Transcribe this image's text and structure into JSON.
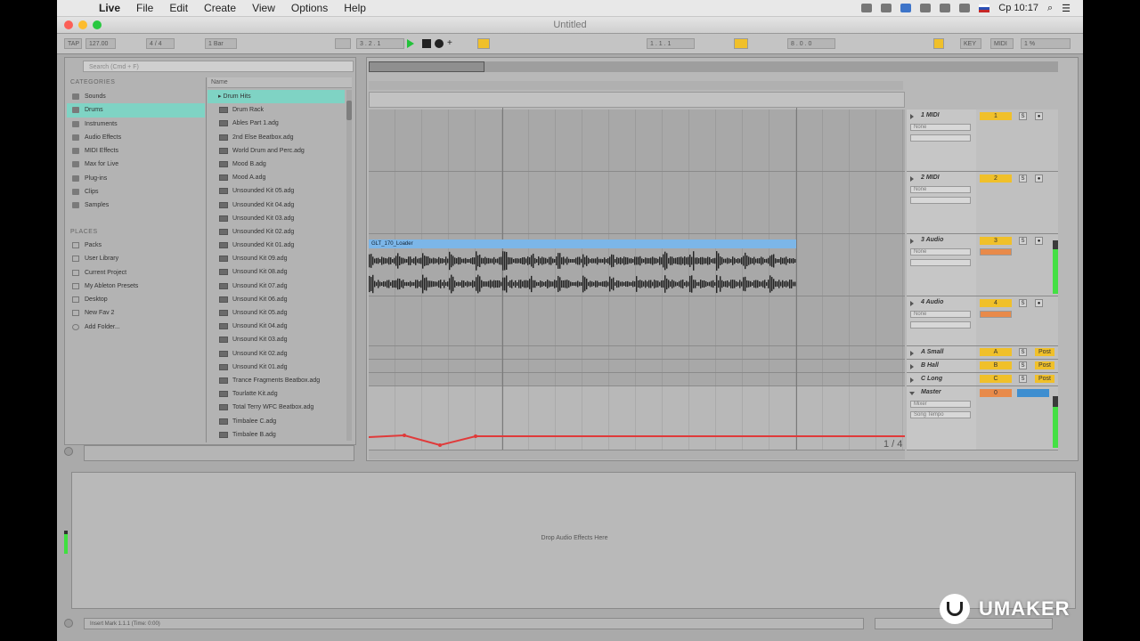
{
  "menubar": {
    "items": [
      "Live",
      "File",
      "Edit",
      "Create",
      "View",
      "Options",
      "Help"
    ],
    "clock": "Ср 10:17"
  },
  "window": {
    "title": "Untitled"
  },
  "transport": {
    "tap": "TAP",
    "tempo": "127.00",
    "signature": "4 / 4",
    "quantize": "1 Bar",
    "position": "3 . 2 . 1",
    "loop_start": "1 . 1 . 1",
    "loop_length": "8 . 0 . 0",
    "key": "KEY",
    "midi": "MIDI",
    "cpu": "1 %"
  },
  "browser": {
    "search_placeholder": "Search (Cmd + F)",
    "categories_header": "CATEGORIES",
    "categories": [
      {
        "label": "Sounds",
        "selected": false
      },
      {
        "label": "Drums",
        "selected": true
      },
      {
        "label": "Instruments",
        "selected": false
      },
      {
        "label": "Audio Effects",
        "selected": false
      },
      {
        "label": "MIDI Effects",
        "selected": false
      },
      {
        "label": "Max for Live",
        "selected": false
      },
      {
        "label": "Plug-ins",
        "selected": false
      },
      {
        "label": "Clips",
        "selected": false
      },
      {
        "label": "Samples",
        "selected": false
      }
    ],
    "places_header": "PLACES",
    "places": [
      "Packs",
      "User Library",
      "Current Project",
      "My Ableton Presets",
      "Desktop",
      "New Fav 2",
      "Add Folder..."
    ],
    "files_header": "Name",
    "files": [
      {
        "label": "Drum Hits",
        "folder": true
      },
      {
        "label": "Drum Rack",
        "folder": false
      },
      {
        "label": "Ables Part 1.adg",
        "folder": false
      },
      {
        "label": "2nd Else Beatbox.adg",
        "folder": false
      },
      {
        "label": "World Drum and Perc.adg",
        "folder": false
      },
      {
        "label": "Mood B.adg",
        "folder": false
      },
      {
        "label": "Mood A.adg",
        "folder": false
      },
      {
        "label": "Unsounded Kit 05.adg",
        "folder": false
      },
      {
        "label": "Unsounded Kit 04.adg",
        "folder": false
      },
      {
        "label": "Unsounded Kit 03.adg",
        "folder": false
      },
      {
        "label": "Unsounded Kit 02.adg",
        "folder": false
      },
      {
        "label": "Unsounded Kit 01.adg",
        "folder": false
      },
      {
        "label": "Unsound Kit 09.adg",
        "folder": false
      },
      {
        "label": "Unsound Kit 08.adg",
        "folder": false
      },
      {
        "label": "Unsound Kit 07.adg",
        "folder": false
      },
      {
        "label": "Unsound Kit 06.adg",
        "folder": false
      },
      {
        "label": "Unsound Kit 05.adg",
        "folder": false
      },
      {
        "label": "Unsound Kit 04.adg",
        "folder": false
      },
      {
        "label": "Unsound Kit 03.adg",
        "folder": false
      },
      {
        "label": "Unsound Kit 02.adg",
        "folder": false
      },
      {
        "label": "Unsound Kit 01.adg",
        "folder": false
      },
      {
        "label": "Trance Fragments Beatbox.adg",
        "folder": false
      },
      {
        "label": "Tourlatte Kit.adg",
        "folder": false
      },
      {
        "label": "Total Terry WFC Beatbox.adg",
        "folder": false
      },
      {
        "label": "Timbalee C.adg",
        "folder": false
      },
      {
        "label": "Timbalee B.adg",
        "folder": false
      }
    ]
  },
  "arrangement": {
    "clip_name": "GLT_170_Loader",
    "tracks": [
      {
        "name": "1 MIDI",
        "number": "1",
        "input": "None"
      },
      {
        "name": "2 MIDI",
        "number": "2",
        "input": "None"
      },
      {
        "name": "3 Audio",
        "number": "3",
        "input": "None"
      },
      {
        "name": "4 Audio",
        "number": "4",
        "input": "None"
      },
      {
        "name": "A Small",
        "number": "A",
        "input": ""
      },
      {
        "name": "B Hall",
        "number": "B",
        "input": ""
      },
      {
        "name": "C Long",
        "number": "C",
        "input": ""
      },
      {
        "name": "Master",
        "number": "0",
        "input": "Mixer"
      }
    ],
    "master_tempo": "Song Tempo",
    "post_label": "Post",
    "page_count": "1 / 4"
  },
  "device_view": {
    "drop_text": "Drop Audio Effects Here"
  },
  "status": {
    "text": "Insert Mark 1.1.1 (Time: 0:00)"
  },
  "watermark": {
    "text": "UMAKER"
  },
  "colors": {
    "accent_teal": "#7fd3c4",
    "clip_blue": "#7cb6e8",
    "track_yellow": "#f0c02a",
    "automation_red": "#e03a3a",
    "meter_green": "#44e044"
  }
}
